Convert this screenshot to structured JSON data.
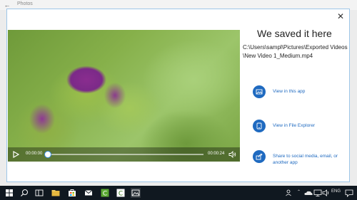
{
  "window": {
    "app_title": "Photos"
  },
  "dialog": {
    "heading": "We saved it here",
    "path": "C:\\Users\\sampl\\Pictures\\Exported Videos\\New Video 1_Medium.mp4",
    "actions": [
      {
        "label": "View in this app",
        "icon": "image-icon"
      },
      {
        "label": "View in File Explorer",
        "icon": "folder-icon"
      },
      {
        "label": "Share to social media, email, or another app",
        "icon": "share-icon"
      }
    ]
  },
  "player": {
    "current_time": "00:00:00",
    "total_time": "00:00:24",
    "progress": 0.0
  },
  "taskbar": {
    "language": "ENG",
    "colors": {
      "background": "#101820"
    }
  },
  "colors": {
    "accent": "#1f6ac0",
    "dialog_border": "#9ec6e8"
  }
}
